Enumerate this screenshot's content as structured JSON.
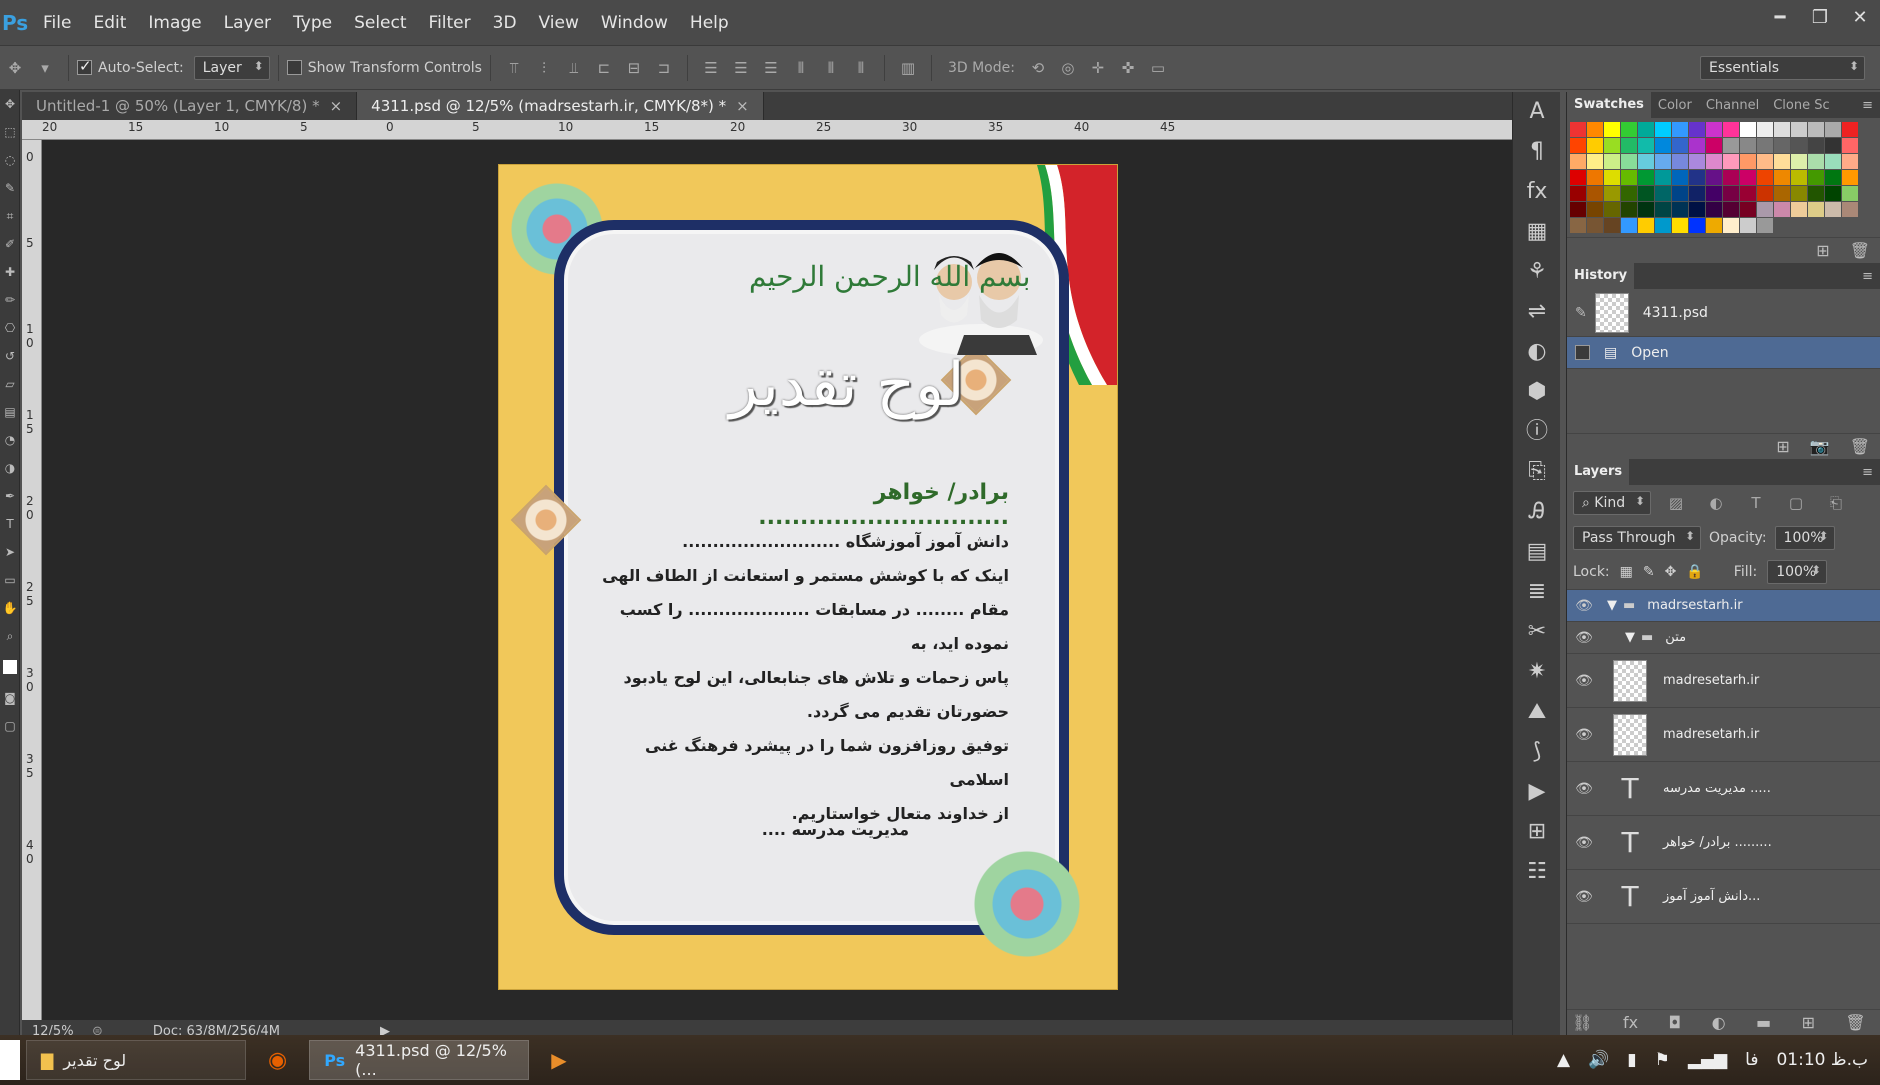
{
  "menubar": {
    "items": [
      "File",
      "Edit",
      "Image",
      "Layer",
      "Type",
      "Select",
      "Filter",
      "3D",
      "View",
      "Window",
      "Help"
    ],
    "window_controls": {
      "minimize": "━",
      "restore": "❐",
      "close": "✕"
    }
  },
  "options": {
    "auto_select_label": "Auto-Select:",
    "auto_select_value": "Layer",
    "show_transform_label": "Show Transform Controls",
    "mode_3d_label": "3D Mode:",
    "workspace": "Essentials"
  },
  "tabs": [
    {
      "label": "Untitled-1 @ 50% (Layer 1, CMYK/8) *",
      "close": "×"
    },
    {
      "label": "4311.psd @ 12/5% (madrsestarh.ir, CMYK/8*) *",
      "close": "×"
    }
  ],
  "ruler_top": [
    "20",
    "15",
    "10",
    "5",
    "0",
    "5",
    "10",
    "15",
    "20",
    "25",
    "30",
    "35",
    "40",
    "45"
  ],
  "ruler_left": [
    "0",
    "5",
    "1 0",
    "1 5",
    "2 0",
    "2 5",
    "3 0",
    "3 5",
    "4 0"
  ],
  "document": {
    "calligraphy": "بسم الله الرحمن الرحیم",
    "title": "لوح تقدیر",
    "subtitle": "برادر/ خواهر ..............................",
    "lines": [
      "دانش آموز آموزشگاه ..........................",
      "اینک که با کوشش مستمر و استعانت از الطاف الهی",
      "مقام ........ در مسابقات .................... را کسب نموده اید، به",
      "پاس زحمات و تلاش های جنابعالی، این لوح یادبود",
      "حضورتان تقدیم می گردد.",
      "توفیق روزافزون شما را در پیشرد فرهنگ غنی اسلامی",
      "از خداوند متعال خواستاریم."
    ],
    "signature": "مدیریت مدرسه ...."
  },
  "status": {
    "zoom": "12/5%",
    "doc": "Doc: 63/8M/256/4M"
  },
  "swatches_panel": {
    "tabs": [
      "Swatches",
      "Color",
      "Channel",
      "Clone Sc"
    ],
    "colors": [
      "#e33",
      "#f80",
      "#ff0",
      "#3c3",
      "#0a9",
      "#0cf",
      "#39f",
      "#63c",
      "#c3c",
      "#f39",
      "#fff",
      "#eee",
      "#ddd",
      "#ccc",
      "#bbb",
      "#aaa",
      "#e22",
      "#f40",
      "#fc0",
      "#9d2",
      "#2b6",
      "#1ba",
      "#08d",
      "#36c",
      "#a3c",
      "#c06",
      "#999",
      "#888",
      "#777",
      "#666",
      "#555",
      "#444",
      "#333",
      "#f66",
      "#fa6",
      "#fe8",
      "#ce8",
      "#8d9",
      "#6cd",
      "#6ae",
      "#78d",
      "#a8d",
      "#d8c",
      "#f9b",
      "#f96",
      "#fb8",
      "#fd9",
      "#dea",
      "#ada",
      "#9db",
      "#fa8",
      "#d00",
      "#e70",
      "#dd0",
      "#6b0",
      "#093",
      "#099",
      "#06b",
      "#238",
      "#618",
      "#a05",
      "#c06",
      "#e40",
      "#e80",
      "#bb0",
      "#490",
      "#071",
      "#f90",
      "#900",
      "#a50",
      "#990",
      "#360",
      "#052",
      "#066",
      "#048",
      "#126",
      "#406",
      "#704",
      "#903",
      "#c30",
      "#a60",
      "#880",
      "#250",
      "#040",
      "#8c6",
      "#600",
      "#740",
      "#660",
      "#240",
      "#031",
      "#044",
      "#035",
      "#014",
      "#304",
      "#503",
      "#702",
      "#a9a",
      "#c8a",
      "#ec9",
      "#dc8",
      "#cba",
      "#a87",
      "#864",
      "#753",
      "#642",
      "#39f",
      "#fc0",
      "#09c",
      "#fd0",
      "#03f",
      "#ea0",
      "#fec",
      "#ccc",
      "#999"
    ],
    "footer": [
      "new-swatch",
      "delete"
    ]
  },
  "history_panel": {
    "title": "History",
    "snapshot": "4311.psd",
    "steps": [
      "Open"
    ]
  },
  "layers_panel": {
    "title": "Layers",
    "kind": "Kind",
    "blend": "Pass Through",
    "opacity_label": "Opacity:",
    "opacity": "100%",
    "lock_label": "Lock:",
    "fill_label": "Fill:",
    "fill": "100%",
    "rows": [
      {
        "type": "group",
        "name": "madrsestarh.ir",
        "indent": 0,
        "selected": true
      },
      {
        "type": "group",
        "name": "متن",
        "indent": 1,
        "selected": false
      },
      {
        "type": "pixel",
        "name": "madresetarh.ir"
      },
      {
        "type": "pixel",
        "name": "madresetarh.ir"
      },
      {
        "type": "text",
        "name": "مدیریت مدرسه ....."
      },
      {
        "type": "text",
        "name": "برادر/ خواهر ........."
      },
      {
        "type": "text",
        "name": "دانش آموز آموز..."
      }
    ]
  },
  "taskbar": {
    "buttons": [
      "لوح تقدیر",
      "4311.psd @ 12/5% (..."
    ],
    "lang": "فا",
    "clock": "01:10 ب.ظ"
  }
}
